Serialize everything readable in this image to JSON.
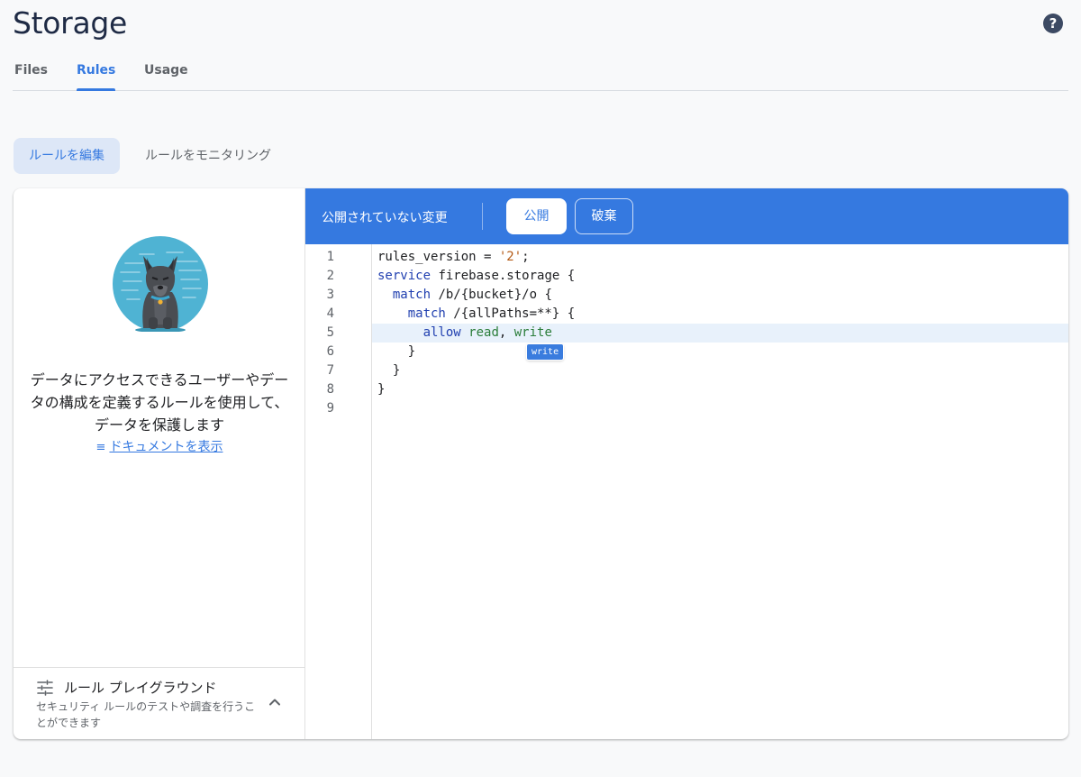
{
  "page": {
    "title": "Storage",
    "help_icon": "help-circle-icon"
  },
  "tabs": [
    {
      "label": "Files"
    },
    {
      "label": "Rules"
    },
    {
      "label": "Usage"
    }
  ],
  "subtabs": {
    "edit": "ルールを編集",
    "monitor": "ルールをモニタリング"
  },
  "left_panel": {
    "description": "データにアクセスできるユーザーやデータの構成を定義するルールを使用して、データを保護します",
    "doc_link": "ドキュメントを表示",
    "playground_title": "ルール プレイグラウンド",
    "playground_subtitle": "セキュリティ ルールのテストや調査を行うことができます"
  },
  "editor": {
    "status": "公開されていない変更",
    "publish": "公開",
    "discard": "破棄",
    "line_numbers": [
      "1",
      "2",
      "3",
      "4",
      "5",
      "6",
      "7",
      "8",
      "9"
    ],
    "code": {
      "l1_a": "rules_version = ",
      "l1_b": "'2'",
      "l1_c": ";",
      "l2_a": "service",
      "l2_b": " firebase.storage {",
      "l3_a": "  match",
      "l3_b": " /b/{bucket}/o {",
      "l4_a": "    match",
      "l4_b": " /{allPaths=**} {",
      "l5_a": "      allow",
      "l5_b": " ",
      "l5_c": "read",
      "l5_d": ", ",
      "l5_e": "write",
      "l6": "    }",
      "l7": "  }",
      "l8": "}"
    },
    "autocomplete": "write"
  },
  "colors": {
    "accent": "#3579e0",
    "keyword": "#2140b0",
    "string": "#b35813",
    "permission": "#2b7d3a"
  }
}
